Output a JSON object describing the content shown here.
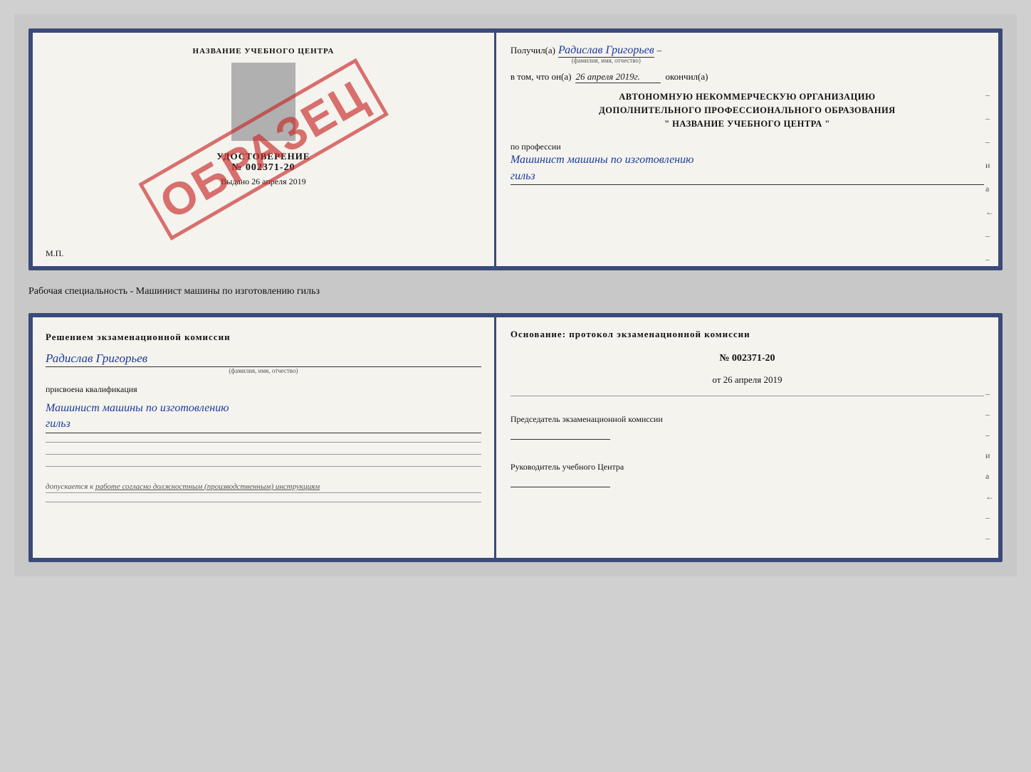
{
  "doc_top": {
    "left": {
      "institution_name": "НАЗВАНИЕ УЧЕБНОГО ЦЕНТРА",
      "cert_label": "УДОСТОВЕРЕНИЕ",
      "cert_number": "№ 002371-20",
      "issued_date_label": "Выдано",
      "issued_date": "26 апреля 2019",
      "mp_label": "М.П.",
      "stamp_text": "ОБРАЗЕЦ"
    },
    "right": {
      "received_label": "Получил(а)",
      "person_name": "Радислав Григорьев",
      "name_caption": "(фамилия, имя, отчество)",
      "date_prefix": "в том, что он(а)",
      "date_value": "26 апреля 2019г.",
      "date_suffix": "окончил(а)",
      "org_line1": "АВТОНОМНУЮ НЕКОММЕРЧЕСКУЮ ОРГАНИЗАЦИЮ",
      "org_line2": "ДОПОЛНИТЕЛЬНОГО ПРОФЕССИОНАЛЬНОГО ОБРАЗОВАНИЯ",
      "org_name_quotes": "\" НАЗВАНИЕ УЧЕБНОГО ЦЕНТРА \"",
      "profession_label": "по профессии",
      "profession_value": "Машинист машины по изготовлению",
      "profession_value2": "гильз"
    }
  },
  "specialty_label": "Рабочая специальность - Машинист машины по изготовлению гильз",
  "doc_bottom": {
    "left": {
      "commission_title": "Решением  экзаменационной  комиссии",
      "person_name": "Радислав Григорьев",
      "name_caption": "(фамилия, имя, отчество)",
      "qualification_label": "присвоена квалификация",
      "qualification_value": "Машинист машины по изготовлению",
      "qualification_value2": "гильз",
      "admission_label": "допускается к",
      "admission_text": "работе согласно должностным (производственным) инструкциям"
    },
    "right": {
      "basis_title": "Основание: протокол экзаменационной  комиссии",
      "basis_number": "№ 002371-20",
      "basis_date_prefix": "от",
      "basis_date": "26 апреля 2019",
      "chairman_title": "Председатель экзаменационной комиссии",
      "director_title": "Руководитель учебного Центра"
    }
  },
  "side_dashes": [
    "-",
    "-",
    "-",
    "и",
    "а",
    "←",
    "-",
    "-"
  ],
  "bottom_dashes": [
    "-",
    "-",
    "-",
    "и",
    "а",
    "←",
    "-",
    "-"
  ]
}
